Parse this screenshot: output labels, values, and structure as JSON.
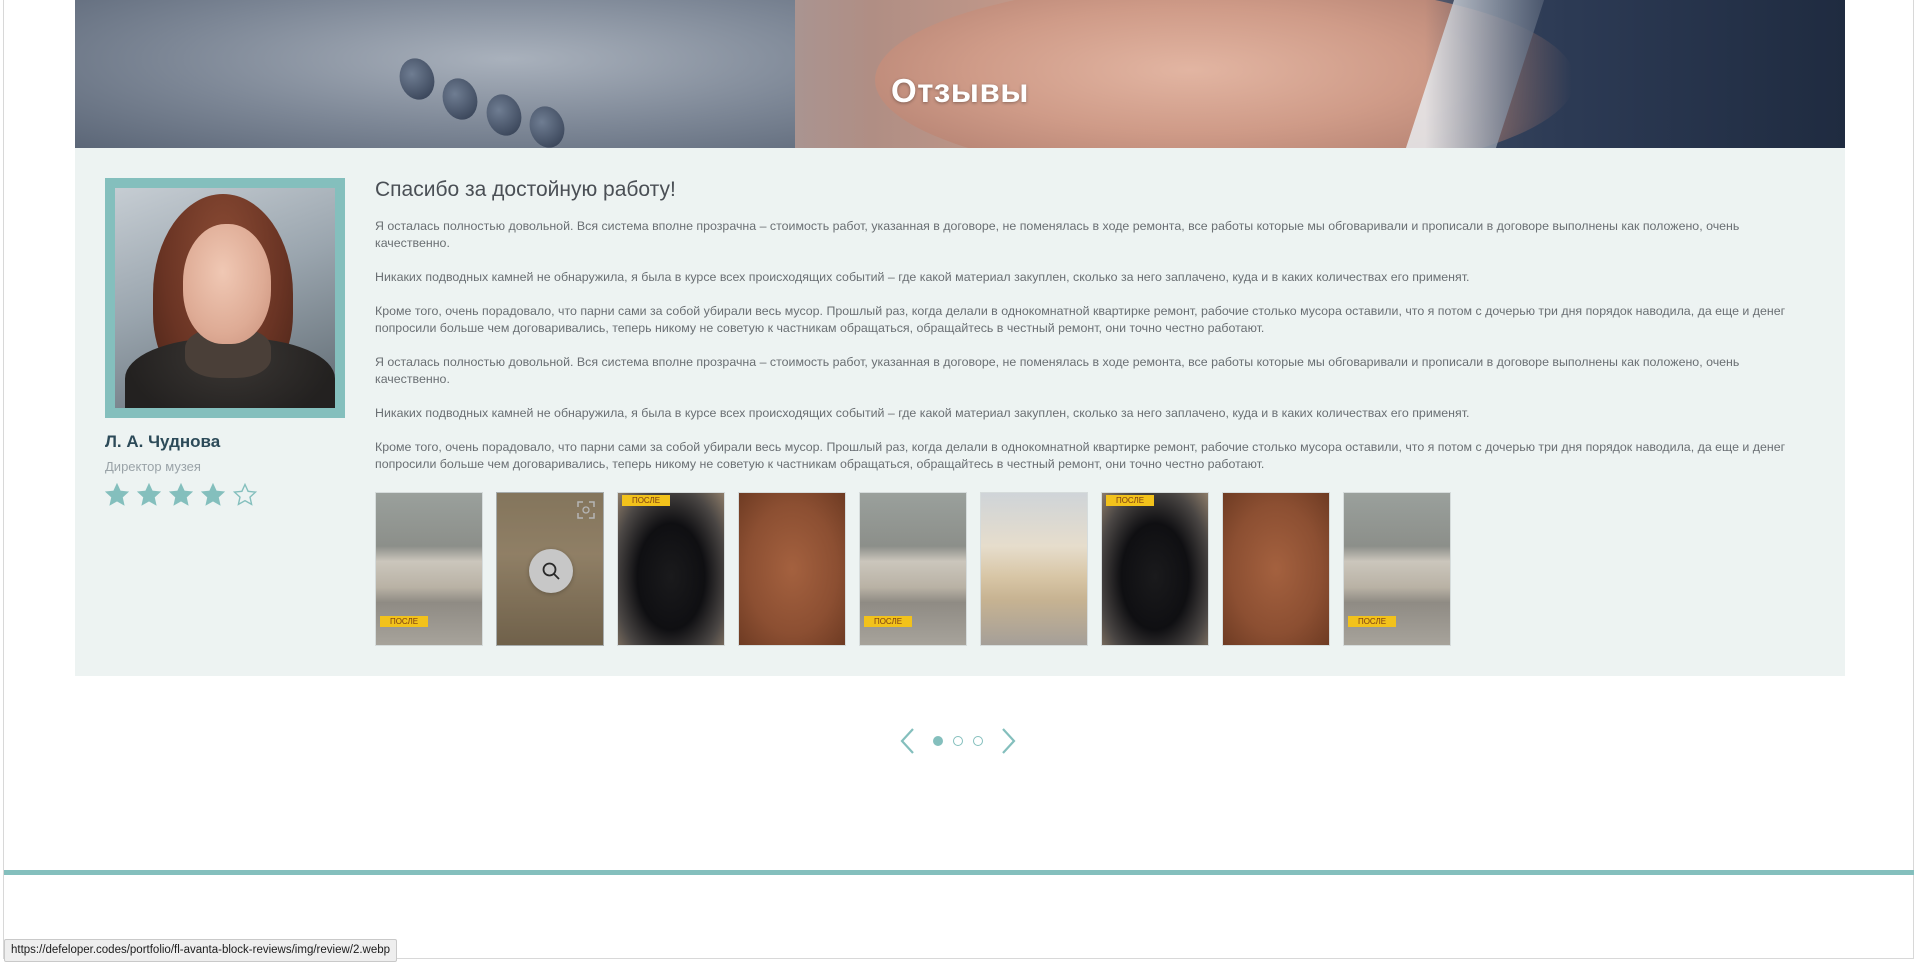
{
  "hero": {
    "title": "Отзывы"
  },
  "review": {
    "reviewer_name": "Л. А. Чуднова",
    "reviewer_role": "Директор музея",
    "rating": 4,
    "rating_max": 5,
    "title": "Спасибо за достойную работу!",
    "paragraphs": [
      "Я осталась полностью довольной. Вся система вполне прозрачна – стоимость работ, указанная в договоре, не поменялась в ходе ремонта, все работы которые мы обговаривали и прописали в договоре выполнены как положено, очень качественно.",
      "Никаких подводных камней не обнаружила, я была в курсе всех происходящих событий – где какой материал закуплен, сколько за него заплачено, куда и в каких количествах его применят.",
      "Кроме того, очень порадовало, что парни сами за собой убирали весь мусор. Прошлый раз, когда делали в однокомнатной квартирке ремонт, рабочие столько мусора оставили, что я потом с дочерью три дня порядок наводила, да еще и денег попросили больше чем договаривались, теперь никому не советую к частникам обращаться, обращайтесь в честный ремонт, они точно честно работают.",
      "Я осталась полностью довольной. Вся система вполне прозрачна – стоимость работ, указанная в договоре, не поменялась в ходе ремонта, все работы которые мы обговаривали и прописали в договоре выполнены как положено, очень качественно.",
      "Никаких подводных камней не обнаружила, я была в курсе всех происходящих событий – где какой материал закуплен, сколько за него заплачено, куда и в каких количествах его применят.",
      "Кроме того, очень порадовало, что парни сами за собой убирали весь мусор. Прошлый раз, когда делали в однокомнатной квартирке ремонт, рабочие столько мусора оставили, что я потом с дочерью три дня порядок наводила, да еще и денег попросили больше чем договаривались, теперь никому не советую к частникам обращаться, обращайтесь в честный ремонт, они точно честно работают."
    ],
    "photos": [
      {
        "kind": "sofa-gray",
        "label": "ПОСЛЕ",
        "label_pos": "bottom"
      },
      {
        "kind": "box",
        "label": "",
        "label_pos": "none",
        "hovered": true
      },
      {
        "kind": "chair",
        "label": "ПОСЛЕ",
        "label_pos": "top"
      },
      {
        "kind": "leather",
        "label": "",
        "label_pos": "none"
      },
      {
        "kind": "sofa-gray",
        "label": "ПОСЛЕ",
        "label_pos": "bottom"
      },
      {
        "kind": "sofa-beige",
        "label": "",
        "label_pos": "none"
      },
      {
        "kind": "chair",
        "label": "ПОСЛЕ",
        "label_pos": "top"
      },
      {
        "kind": "leather",
        "label": "",
        "label_pos": "none"
      },
      {
        "kind": "sofa-gray",
        "label": "ПОСЛЕ",
        "label_pos": "bottom"
      }
    ]
  },
  "pager": {
    "pages": 3,
    "active_page": 1
  },
  "status_bar": {
    "url": "https://defeloper.codes/portfolio/fl-avanta-block-reviews/img/review/2.webp"
  },
  "colors": {
    "accent": "#84bfbd",
    "panel_bg": "#edf3f2",
    "name": "#2c4a58"
  },
  "icons": {
    "star_filled": "star-icon",
    "star_empty": "star-outline-icon",
    "zoom": "search-icon",
    "prev": "chevron-left-icon",
    "next": "chevron-right-icon"
  }
}
